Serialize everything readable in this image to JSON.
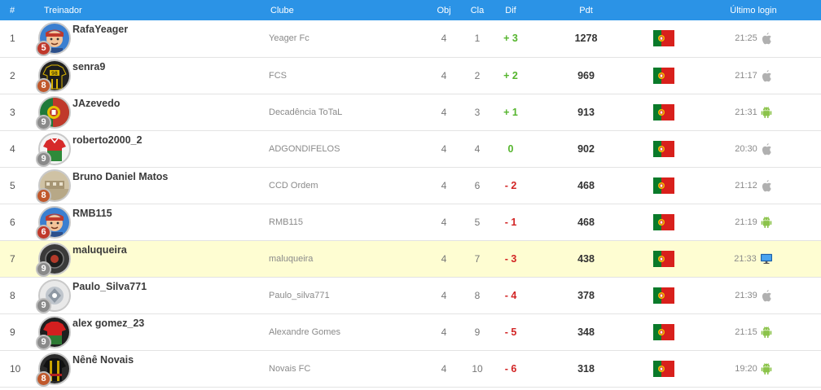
{
  "header": {
    "pos": "#",
    "coach": "Treinador",
    "club": "Clube",
    "obj": "Obj",
    "cla": "Cla",
    "dif": "Dif",
    "pdt": "Pdt",
    "login": "Último login"
  },
  "rows": [
    {
      "pos": "1",
      "name": "RafaYeager",
      "level": "5",
      "level_color": "#c0392b",
      "avatar": "person-face",
      "club": "Yeager Fc",
      "obj": "4",
      "cla": "1",
      "dif": "+ 3",
      "dif_dir": "up",
      "pdt": "1278",
      "flag": "portugal-flag",
      "time": "21:25",
      "device": "apple-icon",
      "highlight": false
    },
    {
      "pos": "2",
      "name": "senra9",
      "level": "8",
      "level_color": "#c0582b",
      "avatar": "jersey-yellow-black",
      "club": "FCS",
      "obj": "4",
      "cla": "2",
      "dif": "+ 2",
      "dif_dir": "up",
      "pdt": "969",
      "flag": "portugal-flag",
      "time": "21:17",
      "device": "apple-icon",
      "highlight": false
    },
    {
      "pos": "3",
      "name": "JAzevedo",
      "level": "9",
      "level_color": "#8a8a8a",
      "avatar": "portugal-crest",
      "club": "Decadência ToTaL",
      "obj": "4",
      "cla": "3",
      "dif": "+ 1",
      "dif_dir": "up",
      "pdt": "913",
      "flag": "portugal-flag",
      "time": "21:31",
      "device": "android-icon",
      "highlight": false
    },
    {
      "pos": "4",
      "name": "roberto2000_2",
      "level": "9",
      "level_color": "#8a8a8a",
      "avatar": "jersey-red-green",
      "club": "ADGONDIFELOS",
      "obj": "4",
      "cla": "4",
      "dif": "0",
      "dif_dir": "up",
      "pdt": "902",
      "flag": "portugal-flag",
      "time": "20:30",
      "device": "apple-icon",
      "highlight": false
    },
    {
      "pos": "5",
      "name": "Bruno Daniel Matos",
      "level": "8",
      "level_color": "#c0582b",
      "avatar": "stadium-photo",
      "club": "CCD Ordem",
      "obj": "4",
      "cla": "6",
      "dif": "- 2",
      "dif_dir": "down",
      "pdt": "468",
      "flag": "portugal-flag",
      "time": "21:12",
      "device": "apple-icon",
      "highlight": false
    },
    {
      "pos": "6",
      "name": "RMB115",
      "level": "6",
      "level_color": "#c0392b",
      "avatar": "person-face",
      "club": "RMB115",
      "obj": "4",
      "cla": "5",
      "dif": "- 1",
      "dif_dir": "down",
      "pdt": "468",
      "flag": "portugal-flag",
      "time": "21:19",
      "device": "android-icon",
      "highlight": false
    },
    {
      "pos": "7",
      "name": "maluqueira",
      "level": "9",
      "level_color": "#8a8a8a",
      "avatar": "dark-crest",
      "club": "maluqueira",
      "obj": "4",
      "cla": "7",
      "dif": "- 3",
      "dif_dir": "down",
      "pdt": "438",
      "flag": "portugal-flag",
      "time": "21:33",
      "device": "desktop-icon",
      "highlight": true
    },
    {
      "pos": "8",
      "name": "Paulo_Silva771",
      "level": "9",
      "level_color": "#8a8a8a",
      "avatar": "grey-crest",
      "club": "Paulo_silva771",
      "obj": "4",
      "cla": "8",
      "dif": "- 4",
      "dif_dir": "down",
      "pdt": "378",
      "flag": "portugal-flag",
      "time": "21:39",
      "device": "apple-icon",
      "highlight": false
    },
    {
      "pos": "9",
      "name": "alex gomez_23",
      "level": "9",
      "level_color": "#8a8a8a",
      "avatar": "jersey-black-red",
      "club": "Alexandre Gomes",
      "obj": "4",
      "cla": "9",
      "dif": "- 5",
      "dif_dir": "down",
      "pdt": "348",
      "flag": "portugal-flag",
      "time": "21:15",
      "device": "android-icon",
      "highlight": false
    },
    {
      "pos": "10",
      "name": "Nênê Novais",
      "level": "8",
      "level_color": "#c0582b",
      "avatar": "jersey-dark-stripes",
      "club": "Novais FC",
      "obj": "4",
      "cla": "10",
      "dif": "- 6",
      "dif_dir": "down",
      "pdt": "318",
      "flag": "portugal-flag",
      "time": "19:20",
      "device": "android-icon",
      "highlight": false
    }
  ],
  "colors": {
    "header_bg": "#2b93e6",
    "highlight_row": "#fefdd2",
    "positive": "#55b52d",
    "negative": "#d22424"
  }
}
